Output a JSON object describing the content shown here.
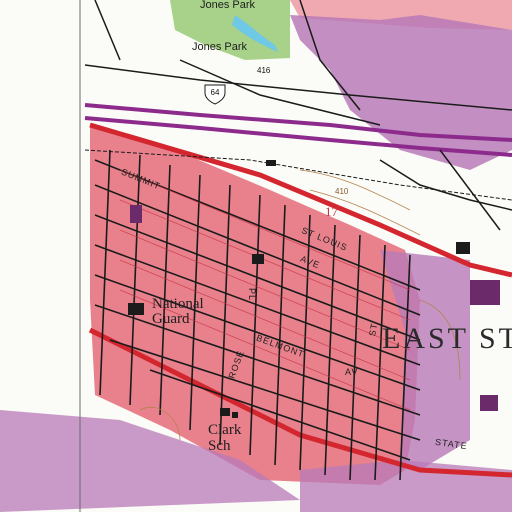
{
  "map": {
    "colors": {
      "background": "#fbfbf7",
      "urban_tint": "#e8818c",
      "building_purple": "#9b4f9b",
      "interstate": "#8c2b8c",
      "red_road": "#d4262e",
      "street_black": "#1b1b1b",
      "park_green": "#a8d18a",
      "water_blue": "#6ec8e6",
      "contour_brown": "#b5834c",
      "grid_red": "#d43c3c"
    },
    "labels": {
      "jones_park_top": "Jones Park",
      "jones_park": "Jones Park",
      "summit": "SUMMIT",
      "national": "National",
      "guard": "Guard",
      "east_st": "EAST ST",
      "belmont": "BELMONT",
      "av": "AV",
      "ave_mid": "AVE",
      "st_right": "ST",
      "pl": "PL",
      "rose": "ROSE",
      "clark": "Clark",
      "sch": "Sch",
      "state": "STATE",
      "contour_410": "410",
      "num_17": "17",
      "num_416": "416",
      "num_64": "64",
      "st_louis": "ST LOUIS"
    },
    "icons": {
      "highway_shield": "interstate-shield-icon",
      "buildings": "building-block-icon"
    }
  }
}
